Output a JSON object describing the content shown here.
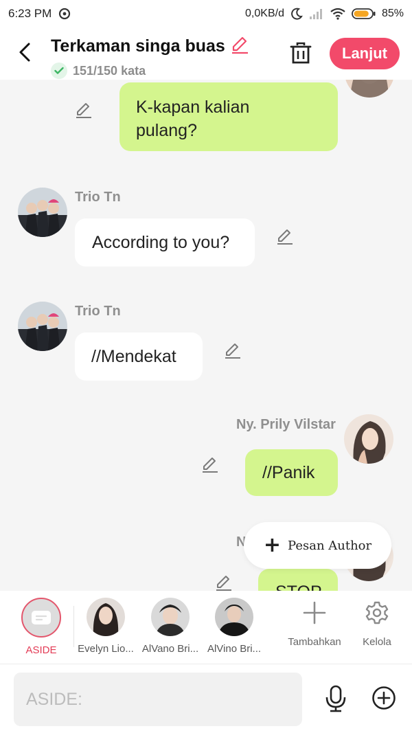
{
  "status_bar": {
    "time": "6:23 PM",
    "network_speed": "0,0KB/d",
    "battery_percent": "85%",
    "battery_level": 0.85
  },
  "header": {
    "title": "Terkaman singa buas",
    "word_count": "151/150 kata",
    "next_label": "Lanjut"
  },
  "messages": [
    {
      "side": "right",
      "sender": "",
      "text_lines": [
        "K-kapan kalian",
        "pulang?"
      ],
      "color": "#d4f58e"
    },
    {
      "side": "left",
      "sender": "Trio Tn",
      "text": "According to you?",
      "color": "#ffffff"
    },
    {
      "side": "left",
      "sender": "Trio Tn",
      "text": "//Mendekat",
      "color": "#ffffff"
    },
    {
      "side": "right",
      "sender": "Ny. Prily Vilstar",
      "text": "//Panik",
      "color": "#d4f58e"
    },
    {
      "side": "right",
      "sender": "N",
      "text": "STOP",
      "color": "#d4f58e"
    }
  ],
  "float_button": {
    "label": "Pesan Author"
  },
  "characters": [
    {
      "name": "ASIDE",
      "active": true
    },
    {
      "name": "Evelyn Lio..."
    },
    {
      "name": "AlVano Bri..."
    },
    {
      "name": "AlVino Bri..."
    }
  ],
  "tools": [
    {
      "label": "Tambahkan",
      "icon": "plus-icon"
    },
    {
      "label": "Kelola",
      "icon": "gear-icon"
    }
  ],
  "input": {
    "placeholder": "ASIDE:"
  },
  "colors": {
    "accent": "#f24a6a",
    "green_bubble": "#d4f58e",
    "aside_red": "#e33b55"
  }
}
